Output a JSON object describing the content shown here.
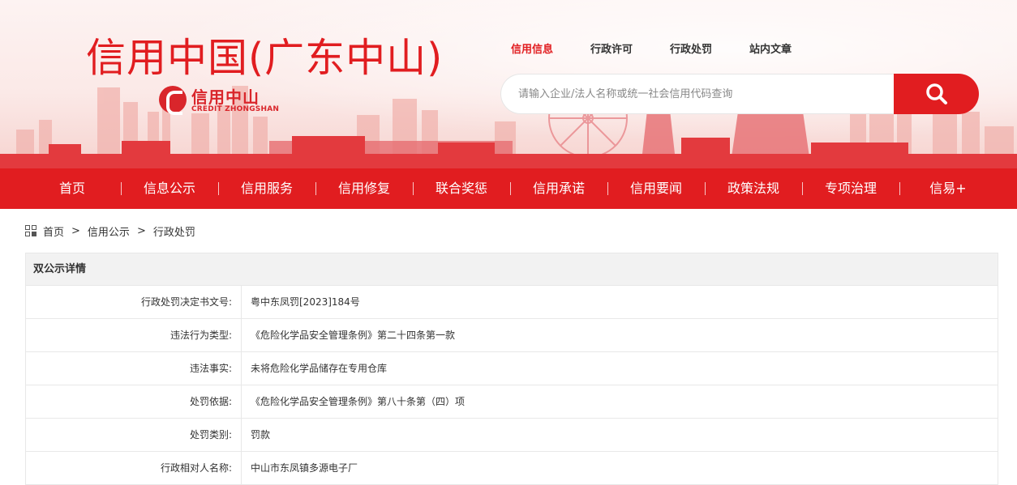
{
  "header": {
    "site_title": "信用中国(广东中山)",
    "logo": {
      "cn": "信用中山",
      "en": "CREDIT ZHONGSHAN"
    },
    "top_links": [
      {
        "label": "信用信息",
        "active": true
      },
      {
        "label": "行政许可",
        "active": false
      },
      {
        "label": "行政处罚",
        "active": false
      },
      {
        "label": "站内文章",
        "active": false
      }
    ],
    "search": {
      "placeholder": "请输入企业/法人名称或统一社会信用代码查询",
      "button_icon": "search-icon"
    }
  },
  "nav": {
    "items": [
      "首页",
      "信息公示",
      "信用服务",
      "信用修复",
      "联合奖惩",
      "信用承诺",
      "信用要闻",
      "政策法规",
      "专项治理",
      "信易+"
    ]
  },
  "breadcrumb": {
    "icon": "grid-icon",
    "items": [
      "首页",
      "信用公示",
      "行政处罚"
    ],
    "separator": ">"
  },
  "detail": {
    "title": "双公示详情",
    "rows": [
      {
        "label": "行政处罚决定书文号:",
        "value": "粤中东凤罚[2023]184号"
      },
      {
        "label": "违法行为类型:",
        "value": "《危险化学品安全管理条例》第二十四条第一款"
      },
      {
        "label": "违法事实:",
        "value": "未将危险化学品储存在专用仓库"
      },
      {
        "label": "处罚依据:",
        "value": "《危险化学品安全管理条例》第八十条第（四）项"
      },
      {
        "label": "处罚类别:",
        "value": "罚款"
      },
      {
        "label": "行政相对人名称:",
        "value": "中山市东凤镇多源电子厂"
      }
    ]
  },
  "colors": {
    "brand_red": "#e11d20",
    "header_bg": "#f2f2f2",
    "border": "#e8e8e8"
  }
}
